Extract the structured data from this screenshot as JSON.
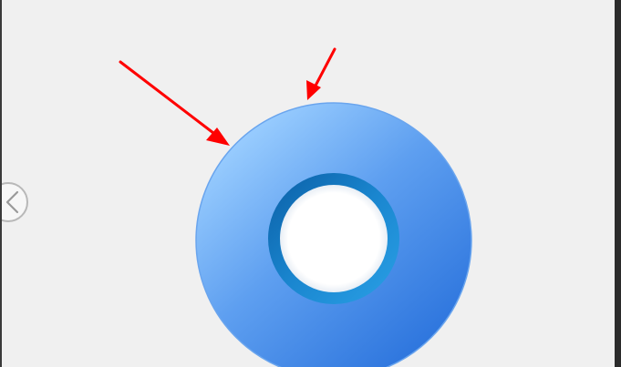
{
  "viewer": {
    "prev_icon": "chevron-left-icon",
    "content_icon": "disc-icon"
  },
  "colors": {
    "canvas_bg": "#f0f0f0",
    "frame_dark": "#2b2b2b",
    "disc_light": "#8ec6ff",
    "disc_mid": "#5c9cf0",
    "disc_dark": "#2f78e0",
    "ring_dark": "#0f6fb6",
    "ring_light": "#2b95db",
    "arrow_red": "#ff0000"
  },
  "annotations": [
    {
      "type": "arrow",
      "label": ""
    },
    {
      "type": "arrow",
      "label": ""
    }
  ]
}
